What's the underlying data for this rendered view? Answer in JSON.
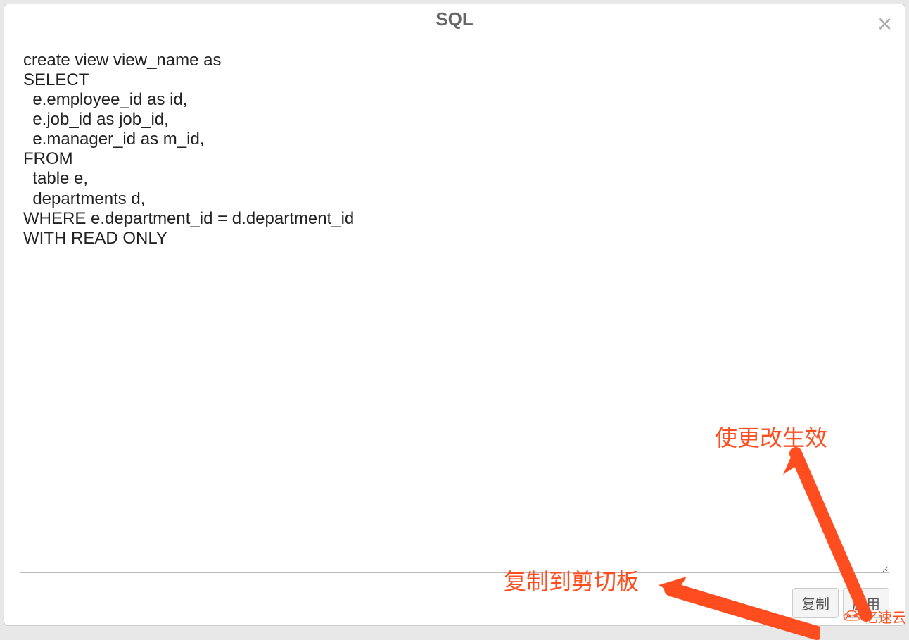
{
  "modal": {
    "title": "SQL",
    "close_label": "×"
  },
  "editor": {
    "sql_content": "create view view_name as\nSELECT\n  e.employee_id as id,\n  e.job_id as job_id,\n  e.manager_id as m_id,\nFROM\n  table e,\n  departments d,\nWHERE e.department_id = d.department_id\nWITH READ ONLY"
  },
  "footer": {
    "copy_label": "复制",
    "apply_label": "应用"
  },
  "annotations": {
    "apply_note": "使更改生效",
    "copy_note": "复制到剪切板"
  },
  "watermark": {
    "text": "亿速云"
  }
}
